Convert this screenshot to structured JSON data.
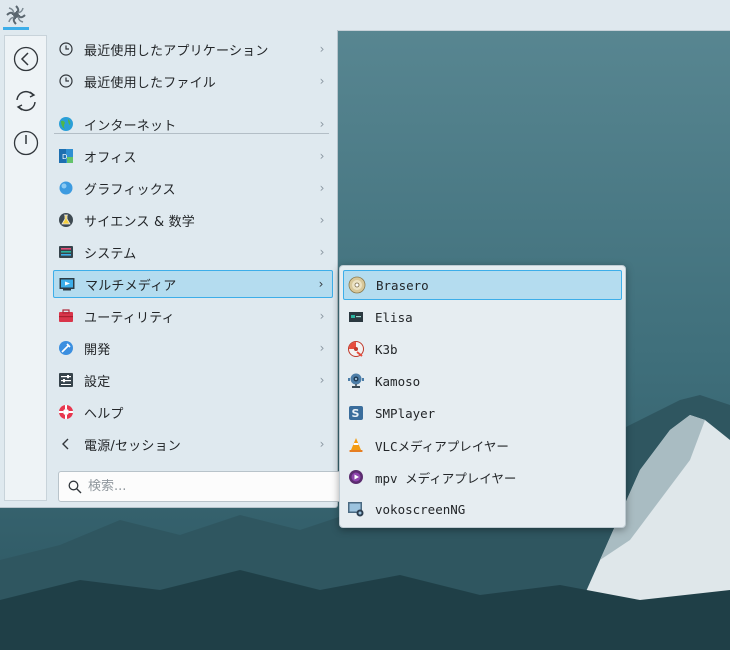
{
  "colors": {
    "accent": "#3daee9",
    "menu_bg": "#dfe9ef",
    "highlight": "#b4dcef"
  },
  "panel": {
    "launcher_icon": "kde-launcher-icon"
  },
  "sidebar": {
    "buttons": [
      {
        "icon": "back-arrow-icon"
      },
      {
        "icon": "refresh-icon"
      },
      {
        "icon": "power-icon"
      }
    ]
  },
  "menu": {
    "recent_apps": "最近使用したアプリケーション",
    "recent_files": "最近使用したファイル",
    "categories": [
      {
        "label": "インターネット",
        "icon": "globe-icon"
      },
      {
        "label": "オフィス",
        "icon": "office-icon"
      },
      {
        "label": "グラフィックス",
        "icon": "graphics-icon"
      },
      {
        "label": "サイエンス & 数学",
        "icon": "science-icon"
      },
      {
        "label": "システム",
        "icon": "system-icon"
      },
      {
        "label": "マルチメディア",
        "icon": "multimedia-icon",
        "active": true
      },
      {
        "label": "ユーティリティ",
        "icon": "toolbox-icon"
      },
      {
        "label": "開発",
        "icon": "development-icon"
      },
      {
        "label": "設定",
        "icon": "settings-icon"
      },
      {
        "label": "ヘルプ",
        "icon": "help-icon"
      },
      {
        "label": "電源/セッション",
        "icon": "back-chevron-icon"
      }
    ],
    "search_placeholder": "検索..."
  },
  "submenu": {
    "items": [
      {
        "label": "Brasero",
        "icon": "disc-burner-icon",
        "active": true
      },
      {
        "label": "Elisa",
        "icon": "music-player-icon"
      },
      {
        "label": "K3b",
        "icon": "k3b-icon"
      },
      {
        "label": "Kamoso",
        "icon": "webcam-icon"
      },
      {
        "label": "SMPlayer",
        "icon": "smplayer-icon"
      },
      {
        "label": "VLCメディアプレイヤー",
        "icon": "vlc-cone-icon"
      },
      {
        "label": "mpv メディアプレイヤー",
        "icon": "mpv-icon"
      },
      {
        "label": "vokoscreenNG",
        "icon": "screen-recorder-icon"
      }
    ]
  }
}
